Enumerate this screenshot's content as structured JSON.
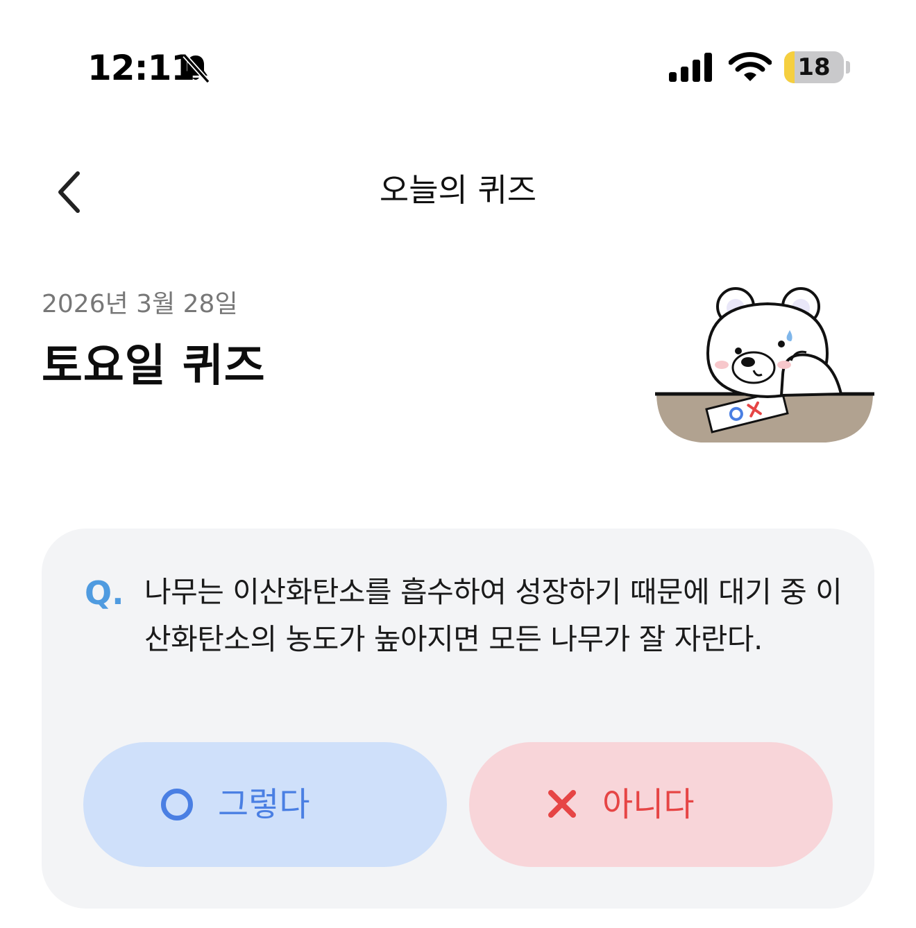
{
  "status_bar": {
    "time": "12:11",
    "muted_icon": "bell-slash-icon",
    "signal_icon": "cellular-signal-icon",
    "wifi_icon": "wifi-icon",
    "battery_level": 18,
    "battery_label": "18",
    "battery_color": "#f5cf3f"
  },
  "header": {
    "back_icon": "chevron-left-icon",
    "title": "오늘의 퀴즈"
  },
  "quiz": {
    "date": "2026년 3월 28일",
    "title": "토요일 퀴즈",
    "illustration": "bear-thinking-illustration",
    "question_marker": "Q.",
    "question": "나무는 이산화탄소를 흡수하여 성장하기 때문에 대기 중 이산화탄소의 농도가 높아지면 모든 나무가 잘 자란다.",
    "answers": [
      {
        "icon": "circle-o-icon",
        "label": "그렇다",
        "color": "#4a7fe3",
        "background": "#cfe0fa"
      },
      {
        "icon": "x-mark-icon",
        "label": "아니다",
        "color": "#e64545",
        "background": "#f8d5d9"
      }
    ]
  },
  "colors": {
    "card_background": "#f3f4f6",
    "question_marker": "#4f9be0"
  }
}
